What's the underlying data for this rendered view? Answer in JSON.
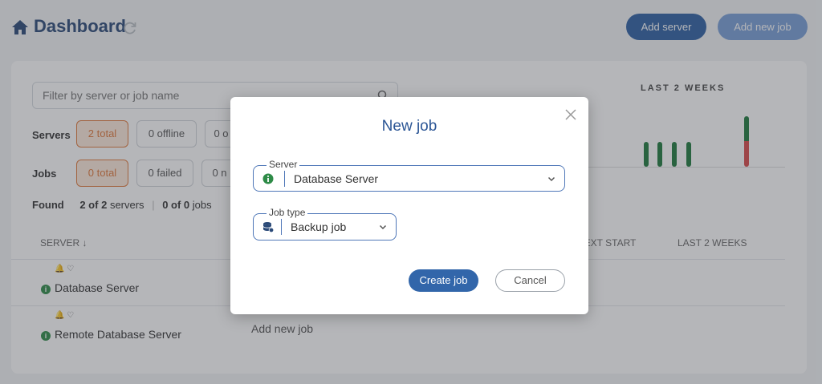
{
  "header": {
    "title": "Dashboard",
    "add_server_label": "Add server",
    "add_new_job_label": "Add new job"
  },
  "filters": {
    "search_placeholder": "Filter by server or job name",
    "servers_label": "Servers",
    "servers_total": "2 total",
    "servers_offline": "0 offline",
    "servers_third": "0 o",
    "jobs_label": "Jobs",
    "jobs_total": "0 total",
    "jobs_failed": "0 failed",
    "jobs_third": "0 n",
    "found_label": "Found",
    "found_servers_count": "2 of 2",
    "found_servers_word": "servers",
    "found_jobs_count": "0 of 0",
    "found_jobs_word": "jobs"
  },
  "summary_chart": {
    "title": "LAST 2 WEEKS",
    "colors": {
      "success": "#1e7a3c",
      "failed": "#d84a4a"
    }
  },
  "table": {
    "col_server": "SERVER",
    "col_next_start": "NEXT START",
    "col_last_2_weeks": "LAST 2 WEEKS",
    "rows": [
      {
        "name": "Database Server"
      },
      {
        "name": "Remote Database Server",
        "action": "Add new job"
      }
    ]
  },
  "modal": {
    "title": "New job",
    "server_legend": "Server",
    "server_value": "Database Server",
    "job_type_legend": "Job type",
    "job_type_value": "Backup job",
    "create_label": "Create job",
    "cancel_label": "Cancel"
  }
}
